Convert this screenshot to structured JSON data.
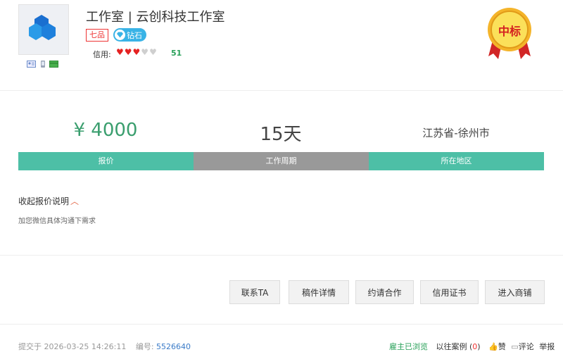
{
  "profile": {
    "title": "工作室 | 云创科技工作室",
    "rank_badge": "七品",
    "diamond_badge": "钻石",
    "credit_label": "信用:",
    "credit_score": "51",
    "hearts": {
      "filled": 3,
      "total": 5
    },
    "medal_text": "中标",
    "verify_icons": [
      "id-card-icon",
      "phone-icon",
      "bank-card-icon"
    ]
  },
  "stats": {
    "price_value": "¥ 4000",
    "price_label": "报价",
    "period_value": "15天",
    "period_label": "工作周期",
    "region_value": "江苏省-徐州市",
    "region_label": "所在地区"
  },
  "description": {
    "toggle_label": "收起报价说明",
    "toggle_icon": "chevron-up-icon",
    "text": "加您微信具体沟通下需求"
  },
  "actions": {
    "contact": "联系TA",
    "draft_details": "稿件详情",
    "invite": "约请合作",
    "certificate": "信用证书",
    "enter_store": "进入商铺"
  },
  "footer": {
    "submitted_label": "提交于",
    "submitted_time": "2026-03-25 14:26:11",
    "id_label": "编号:",
    "id_value": "5526640",
    "employer_viewed": "雇主已浏览",
    "past_cases_label": "以往案例",
    "past_cases_open": "(",
    "past_cases_count": "0",
    "past_cases_close": ")",
    "like": "赞",
    "comment": "评论",
    "report": "举报"
  },
  "colors": {
    "green_bar": "#4dbfa6",
    "gray_bar": "#999999",
    "price_green": "#3a9e6e",
    "diamond_blue": "#39b3e6",
    "rank_red": "#ee3333"
  }
}
